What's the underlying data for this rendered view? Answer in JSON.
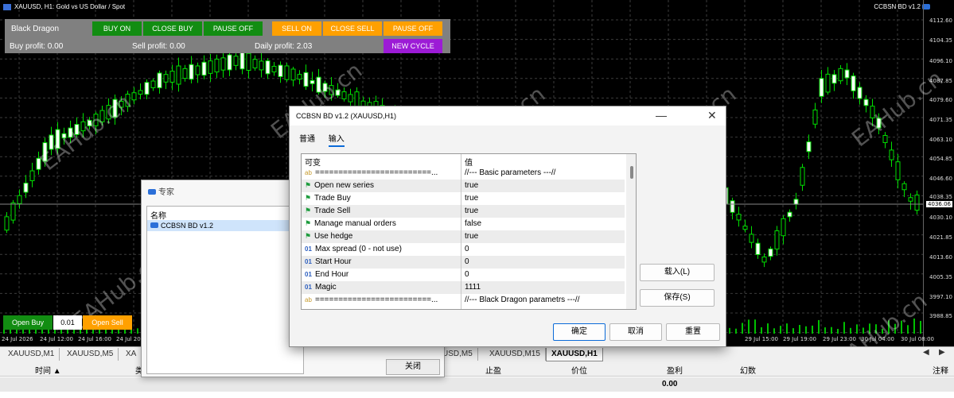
{
  "chart": {
    "title": "XAUUSD, H1:  Gold vs US Dollar / Spot",
    "ea_label": "CCBSN BD v1.2",
    "price_labels": [
      "4112.60",
      "4104.35",
      "4096.10",
      "4087.85",
      "4079.60",
      "4071.35",
      "4063.10",
      "4054.85",
      "4046.60",
      "4038.35",
      "4036.06",
      "4030.10",
      "4021.85",
      "4013.60",
      "4005.35",
      "3997.10",
      "3988.85"
    ],
    "current_price": "4036.06",
    "time_labels": [
      "24 Jul 2026",
      "24 Jul 12:00",
      "24 Jul 16:00",
      "24 Jul 20:00",
      "24 Jul",
      "29 Jul 10:00",
      "29 Jul 15:00",
      "29 Jul 19:00",
      "29 Jul 23:00",
      "30 Jul 04:00",
      "30 Jul 08:00"
    ],
    "watermark": "EAHub.cn",
    "colors": {
      "bull": "#ffffff",
      "bear": "#000000",
      "wick": "#00e000",
      "grid": "#3c3c3c",
      "volume": "#00c000"
    }
  },
  "panel": {
    "title": "Black Dragon",
    "buy_on": "BUY ON",
    "close_buy": "CLOSE BUY",
    "pause_buy": "PAUSE OFF",
    "sell_on": "SELL ON",
    "close_sell": "CLOSE SELL",
    "pause_sell": "PAUSE OFF",
    "buy_profit": "Buy profit: 0.00",
    "sell_profit": "Sell profit: 0.00",
    "daily_profit": "Daily profit: 2.03",
    "new_cycle": "NEW CYCLE",
    "colors": {
      "green": "#128d12",
      "orange": "#ffa000",
      "purple": "#9c1bd6"
    }
  },
  "quick_trade": {
    "open_buy": "Open Buy",
    "lot": "0.01",
    "open_sell": "Open Sell"
  },
  "tabs": [
    {
      "label": "XAUUSD,M1"
    },
    {
      "label": "XAUUSD,M5"
    },
    {
      "label": "XA"
    },
    {
      "label": "USD,M5"
    },
    {
      "label": "XAUUSD,M15"
    },
    {
      "label": "XAUUSD,H1",
      "active": true
    }
  ],
  "tab_nav": {
    "prev": "◀",
    "next": "▶"
  },
  "terminal": {
    "columns": [
      "时间 ▲",
      "类",
      "止盈",
      "价位",
      "盈利",
      "幻数",
      "注释"
    ],
    "total": "0.00"
  },
  "navigator": {
    "title": "专家",
    "column": "名称",
    "item": "CCBSN BD v1.2",
    "close": "关闭"
  },
  "dialog": {
    "title": "CCBSN BD v1.2 (XAUUSD,H1)",
    "minimize": "—",
    "close": "✕",
    "tabs": [
      "普通",
      "输入"
    ],
    "active_tab": 1,
    "header": {
      "name": "可变",
      "value": "值"
    },
    "rows": [
      {
        "icon": "ab",
        "name": "=========================...",
        "value": "//--- Basic parameters ---//"
      },
      {
        "icon": "flag",
        "name": "Open new series",
        "value": "true"
      },
      {
        "icon": "flag",
        "name": "Trade Buy",
        "value": "true"
      },
      {
        "icon": "flag",
        "name": "Trade Sell",
        "value": "true"
      },
      {
        "icon": "flag",
        "name": "Manage manual orders",
        "value": "false"
      },
      {
        "icon": "flag",
        "name": "Use hedge",
        "value": "true"
      },
      {
        "icon": "01",
        "name": "Max spread (0 - not use)",
        "value": "0"
      },
      {
        "icon": "01",
        "name": "Start Hour",
        "value": "0"
      },
      {
        "icon": "01",
        "name": "End Hour",
        "value": "0"
      },
      {
        "icon": "01",
        "name": "Magic",
        "value": "1111"
      },
      {
        "icon": "ab",
        "name": "=========================...",
        "value": "//--- Black Dragon parametrs ---//"
      }
    ],
    "load": "载入(L)",
    "save": "保存(S)",
    "ok": "确定",
    "cancel": "取消",
    "reset": "重置"
  }
}
